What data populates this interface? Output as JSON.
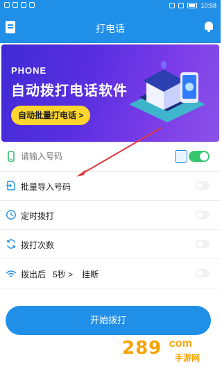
{
  "status_bar": {
    "time": "10:58"
  },
  "app_bar": {
    "title": "打电话"
  },
  "banner": {
    "eyebrow": "PHONE",
    "headline": "自动拨打电话软件",
    "cta": "自动批量打电话 >"
  },
  "phone_input": {
    "placeholder": "请输入号码",
    "value": ""
  },
  "settings": {
    "import_label": "批量导入号码",
    "timer_label": "定时拨打",
    "times_label": "拨打次数",
    "after_label": "拨出后",
    "after_seconds": "5秒 >",
    "after_action": "挂断"
  },
  "start_button": {
    "label": "开始拨打"
  },
  "watermark": {
    "number": "289",
    "suffix": "com",
    "text": "手游网"
  },
  "colors": {
    "primary": "#1f8fe8",
    "toggle_on": "#35c76c",
    "banner_cta": "#ffd52e",
    "watermark": "#f6a300",
    "arrow": "#e03a3a"
  },
  "icons": {
    "menu": "clipboard-icon",
    "bell": "bell-icon",
    "phone": "mobile-phone-icon",
    "import": "import-icon",
    "timer": "clock-icon",
    "times": "refresh-icon",
    "after": "signal-icon"
  }
}
